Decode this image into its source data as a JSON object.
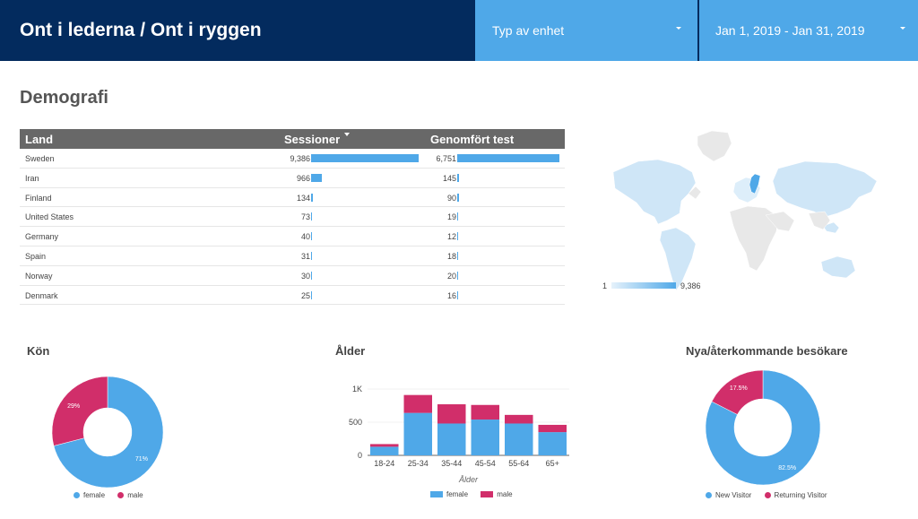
{
  "header": {
    "title": "Ont i lederna / Ont i ryggen",
    "device_filter_label": "Typ av enhet",
    "date_range_label": "Jan 1, 2019 - Jan 31, 2019"
  },
  "section_title": "Demografi",
  "table": {
    "columns": [
      "Land",
      "Sessioner",
      "Genomfört test"
    ],
    "rows": [
      {
        "country": "Sweden",
        "sessions": "9,386",
        "completed": "6,751",
        "sessions_value": 9386,
        "completed_value": 6751
      },
      {
        "country": "Iran",
        "sessions": "966",
        "completed": "145",
        "sessions_value": 966,
        "completed_value": 145
      },
      {
        "country": "Finland",
        "sessions": "134",
        "completed": "90",
        "sessions_value": 134,
        "completed_value": 90
      },
      {
        "country": "United States",
        "sessions": "73",
        "completed": "19",
        "sessions_value": 73,
        "completed_value": 19
      },
      {
        "country": "Germany",
        "sessions": "40",
        "completed": "12",
        "sessions_value": 40,
        "completed_value": 12
      },
      {
        "country": "Spain",
        "sessions": "31",
        "completed": "18",
        "sessions_value": 31,
        "completed_value": 18
      },
      {
        "country": "Norway",
        "sessions": "30",
        "completed": "20",
        "sessions_value": 30,
        "completed_value": 20
      },
      {
        "country": "Denmark",
        "sessions": "25",
        "completed": "16",
        "sessions_value": 25,
        "completed_value": 16
      }
    ]
  },
  "map_legend": {
    "min": "1",
    "max": "9,386"
  },
  "colors": {
    "header_dark": "#032b5e",
    "accent_blue": "#4fa8e8",
    "accent_pink": "#d12e6a",
    "table_header": "#686868"
  },
  "chart_data": [
    {
      "type": "pie",
      "title": "Kön",
      "categories": [
        "female",
        "male"
      ],
      "values": [
        71,
        29
      ],
      "labels": [
        "71%",
        "29%"
      ],
      "colors": [
        "#4fa8e8",
        "#d12e6a"
      ],
      "legend_position": "bottom"
    },
    {
      "type": "bar",
      "stacked": true,
      "title": "Ålder",
      "xlabel": "Ålder",
      "categories": [
        "18-24",
        "25-34",
        "35-44",
        "45-54",
        "55-64",
        "65+"
      ],
      "series": [
        {
          "name": "female",
          "values": [
            130,
            640,
            480,
            540,
            480,
            350
          ],
          "color": "#4fa8e8"
        },
        {
          "name": "male",
          "values": [
            40,
            270,
            290,
            220,
            130,
            110
          ],
          "color": "#d12e6a"
        }
      ],
      "yticks": [
        {
          "v": 0,
          "label": "0"
        },
        {
          "v": 500,
          "label": "500"
        },
        {
          "v": 1000,
          "label": "1K"
        }
      ],
      "ylim": [
        0,
        1000
      ],
      "grid": true,
      "legend_position": "bottom"
    },
    {
      "type": "pie",
      "title": "Nya/återkommande besökare",
      "categories": [
        "New Visitor",
        "Returning Visitor"
      ],
      "values": [
        82.5,
        17.5
      ],
      "labels": [
        "82.5%",
        "17.5%"
      ],
      "colors": [
        "#4fa8e8",
        "#d12e6a"
      ],
      "legend_position": "bottom"
    }
  ]
}
